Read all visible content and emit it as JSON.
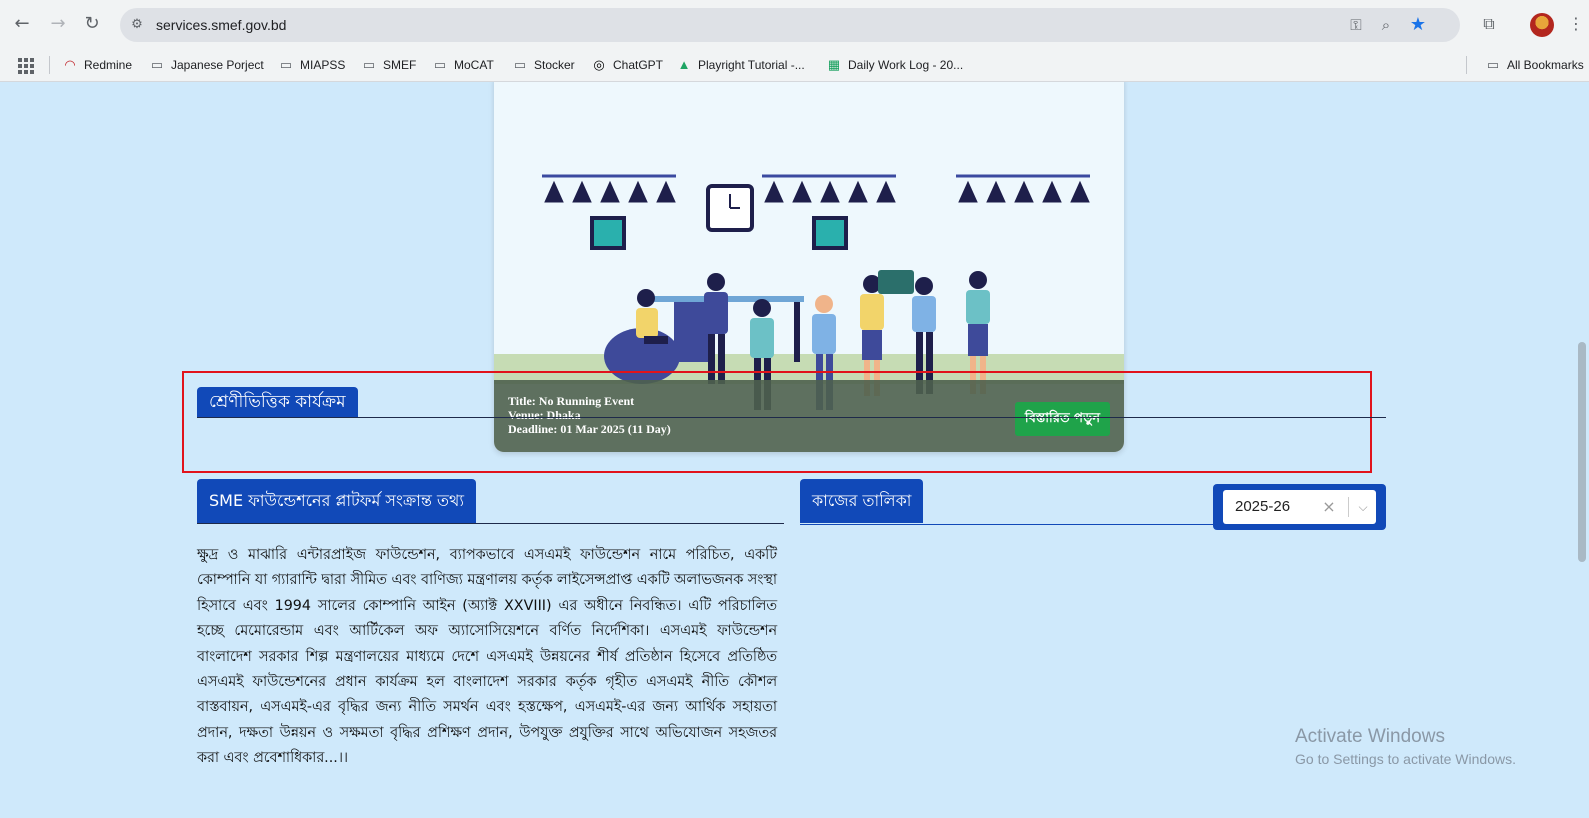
{
  "browser": {
    "url": "services.smef.gov.bd",
    "bookmarks": [
      {
        "label": "Redmine",
        "icon": "redmine-icon"
      },
      {
        "label": "Japanese Porject",
        "icon": "folder-icon"
      },
      {
        "label": "MIAPSS",
        "icon": "folder-icon"
      },
      {
        "label": "SMEF",
        "icon": "folder-icon"
      },
      {
        "label": "MoCAT",
        "icon": "folder-icon"
      },
      {
        "label": "Stocker",
        "icon": "folder-icon"
      },
      {
        "label": "ChatGPT",
        "icon": "chatgpt-icon"
      },
      {
        "label": "Playright Tutorial -...",
        "icon": "google-drive-icon"
      },
      {
        "label": "Daily Work Log - 20...",
        "icon": "google-sheets-icon"
      }
    ],
    "all_bookmarks_label": "All Bookmarks"
  },
  "event": {
    "title_line": "Title: No Running Event",
    "venue_line": "Venue: Dhaka",
    "deadline_line": "Deadline: 01 Mar 2025 (11 Day)",
    "details_button": "বিস্তারিত পড়ুন"
  },
  "category_section": {
    "heading": "শ্রেণীভিত্তিক কার্যক্রম"
  },
  "platform_section": {
    "heading": "SME ফাউন্ডেশনের প্লাটফর্ম সংক্রান্ত তথ্য",
    "body": "ক্ষুদ্র ও মাঝারি এন্টারপ্রাইজ ফাউন্ডেশন, ব্যাপকভাবে এসএমই ফাউন্ডেশন নামে পরিচিত, একটি কোম্পানি যা গ্যারান্টি দ্বারা সীমিত এবং বাণিজ্য মন্ত্রণালয় কর্তৃক লাইসেন্সপ্রাপ্ত একটি অলাভজনক সংস্থা হিসাবে এবং 1994 সালের কোম্পানি আইন (অ্যাক্ট XXVIII) এর অধীনে নিবন্ধিত। এটি পরিচালিত হচ্ছে মেমোরেন্ডাম এবং আর্টিকেল অফ অ্যাসোসিয়েশনে বর্ণিত নির্দেশিকা। এসএমই ফাউন্ডেশন বাংলাদেশ সরকার শিল্প মন্ত্রণালয়ের মাধ্যমে দেশে এসএমই উন্নয়নের শীর্ষ প্রতিষ্ঠান হিসেবে প্রতিষ্ঠিত এসএমই ফাউন্ডেশনের প্রধান কার্যক্রম হল বাংলাদেশ সরকার কর্তৃক গৃহীত এসএমই নীতি কৌশল বাস্তবায়ন, এসএমই-এর বৃদ্ধির জন্য নীতি সমর্থন এবং হস্তক্ষেপ, এসএমই-এর জন্য আর্থিক সহায়তা প্রদান, দক্ষতা উন্নয়ন ও সক্ষমতা বৃদ্ধির প্রশিক্ষণ প্রদান, উপযুক্ত প্রযুক্তির সাথে অভিযোজন সহজতর করা এবং প্রবেশাধিকার...।।"
  },
  "worklist_section": {
    "heading": "কাজের তালিকা",
    "year_selected": "2025-26",
    "clear_symbol": "×"
  },
  "watermark": {
    "line1": "Activate Windows",
    "line2": "Go to Settings to activate Windows."
  },
  "colors": {
    "page_bg": "#cfe9fb",
    "tab_blue": "#1149b8",
    "button_green": "#1fa34a",
    "highlight_red": "#e1131b"
  }
}
